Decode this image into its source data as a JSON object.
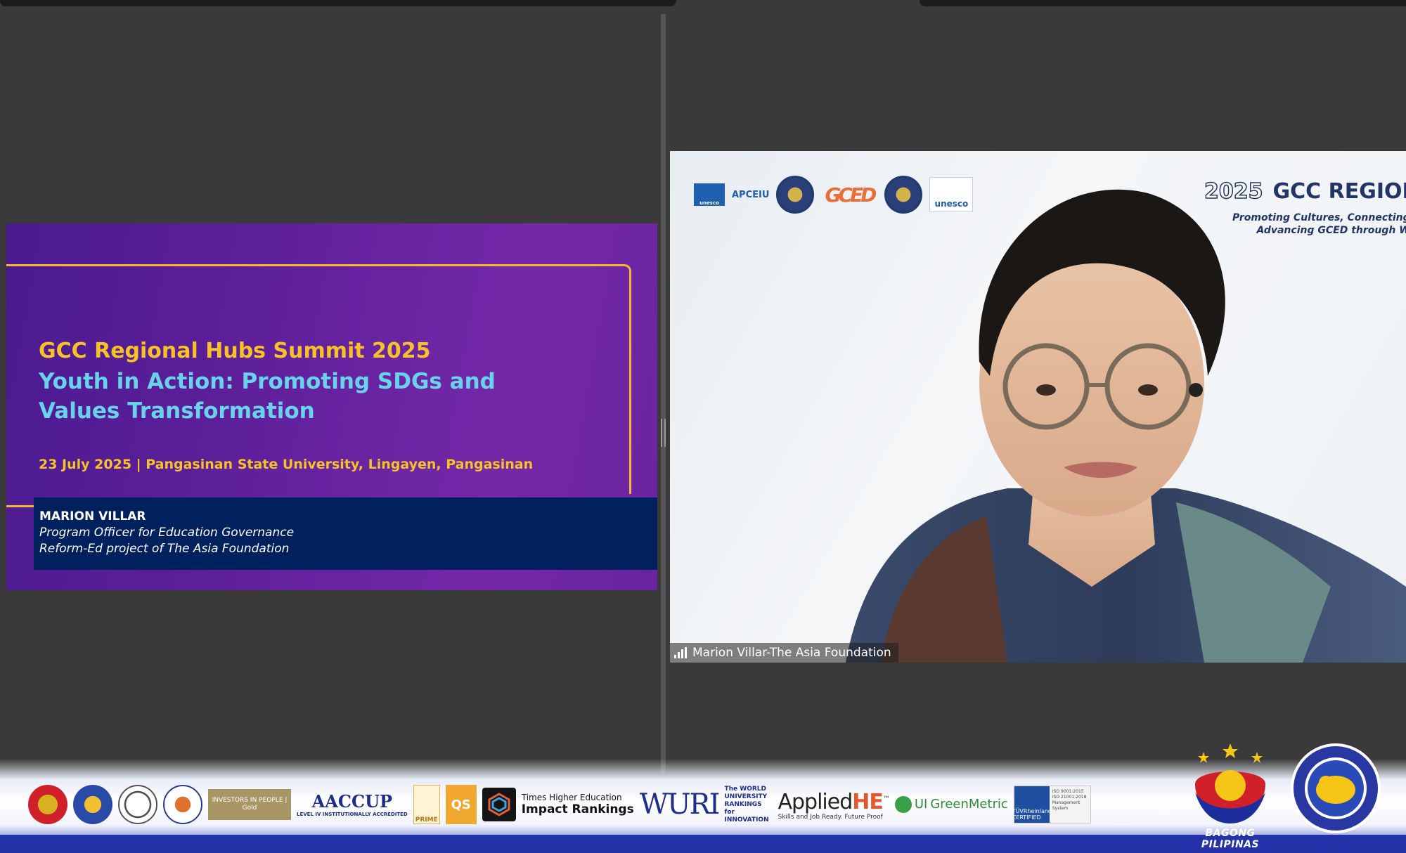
{
  "slide": {
    "title": "GCC Regional Hubs Summit 2025",
    "subtitle": "Youth in Action: Promoting SDGs and Values Transformation",
    "date_line": "23 July 2025 | Pangasinan State University, Lingayen, Pangasinan",
    "speaker": {
      "name": "MARION VILLAR",
      "role_line1": "Program Officer for Education Governance",
      "role_line2": "Reform-Ed project of The Asia Foundation"
    },
    "colors": {
      "accent_yellow": "#f6c227",
      "accent_cyan": "#6ad3ec",
      "bg_purple": "#5d1f9a",
      "name_bar": "#01205e"
    }
  },
  "video": {
    "participant_label": "Marion Villar-The Asia Foundation",
    "background": {
      "heading_year": "2025",
      "heading": "GCC REGIONA",
      "tagline_line1": "Promoting Cultures, Connecting",
      "tagline_line2": "Advancing GCED through W",
      "logo_apceiu": "APCEIU",
      "logo_unesco_left": "unesco",
      "logo_gced": "GCED",
      "logo_unesco_right": "unesco"
    },
    "icons": {
      "signal": "signal-strength-icon"
    }
  },
  "footer": {
    "logos": {
      "investors": "INVESTORS IN PEOPLE | Gold",
      "aaccup": "AACCUP",
      "aaccup_sub": "LEVEL IV INSTITUTIONALLY ACCREDITED",
      "prime": "PRIME",
      "qs": "QS",
      "the_small": "Times Higher Education",
      "the_big": "Impact Rankings",
      "wuri": "WURI",
      "world_rankings": "The WORLD UNIVERSITY RANKINGS for INNOVATION",
      "applied": "Applied",
      "applied_he": "HE",
      "applied_tm": "™",
      "applied_tag": "Skills and Job Ready. Future Proof",
      "green_ui": "UI",
      "green_metric": "GreenMetric",
      "tuv": "TÜVRheinland CERTIFIED",
      "iso": "ISO 9001:2015 ISO 21001:2018 Management System"
    },
    "bagong_pilipinas": "BAGONG PILIPINAS",
    "colors": {
      "band_blue": "#2433a8"
    }
  }
}
